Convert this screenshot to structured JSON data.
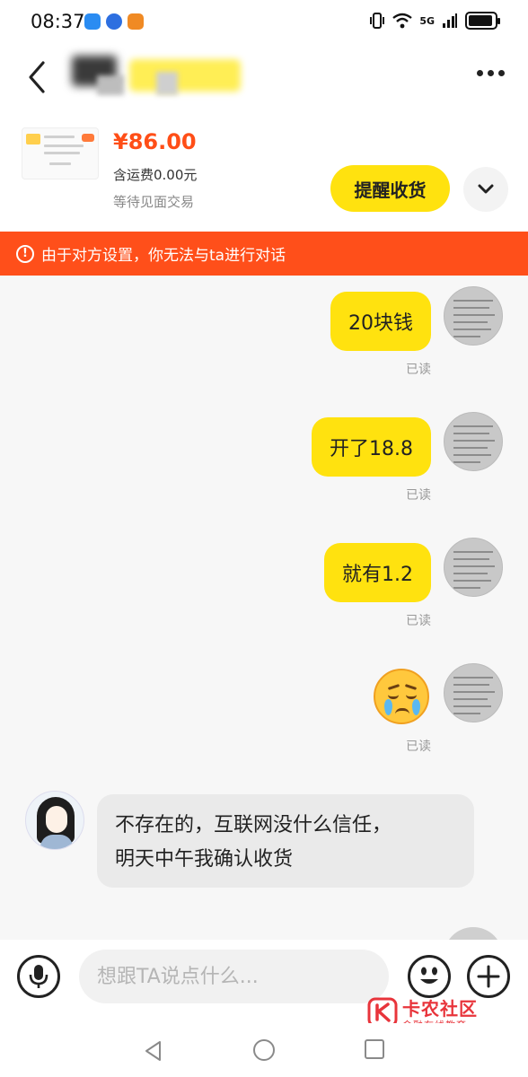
{
  "status_bar": {
    "time": "08:37",
    "network": "5G",
    "icons": [
      "chat-app-icon",
      "browser-app-icon",
      "mail-app-icon",
      "vibrate-icon",
      "wifi-icon",
      "signal-icon",
      "battery-charging-icon"
    ]
  },
  "header": {
    "contact_name_hidden": true,
    "back_icon": "chevron-left-icon",
    "more_icon": "more-dots-icon"
  },
  "product": {
    "price": "¥86.00",
    "shipping": "含运费0.00元",
    "status": "等待见面交易",
    "remind_button": "提醒收货",
    "expand_icon": "chevron-down-icon"
  },
  "warning": {
    "text": "由于对方设置，你无法与ta进行对话",
    "icon": "alert-circle-icon"
  },
  "messages": [
    {
      "from": "me",
      "type": "text",
      "text": "20块钱",
      "status": "已读"
    },
    {
      "from": "me",
      "type": "text",
      "text": "开了18.8",
      "status": "已读"
    },
    {
      "from": "me",
      "type": "text",
      "text": "就有1.2",
      "status": "已读"
    },
    {
      "from": "me",
      "type": "emoji",
      "emoji": "crying-face-emoji",
      "status": "已读"
    },
    {
      "from": "peer",
      "type": "text",
      "line1": "不存在的，互联网没什么信任，",
      "line2": "明天中午我确认收货"
    }
  ],
  "input": {
    "placeholder": "想跟TA说点什么...",
    "value": ""
  },
  "watermark": {
    "title": "卡农社区",
    "subtitle": "金融在线教育"
  },
  "colors": {
    "accent_yellow": "#ffe20f",
    "price_orange": "#ff4e17",
    "warning_red": "#ff4f1a",
    "peer_bubble": "#eaeaea"
  }
}
